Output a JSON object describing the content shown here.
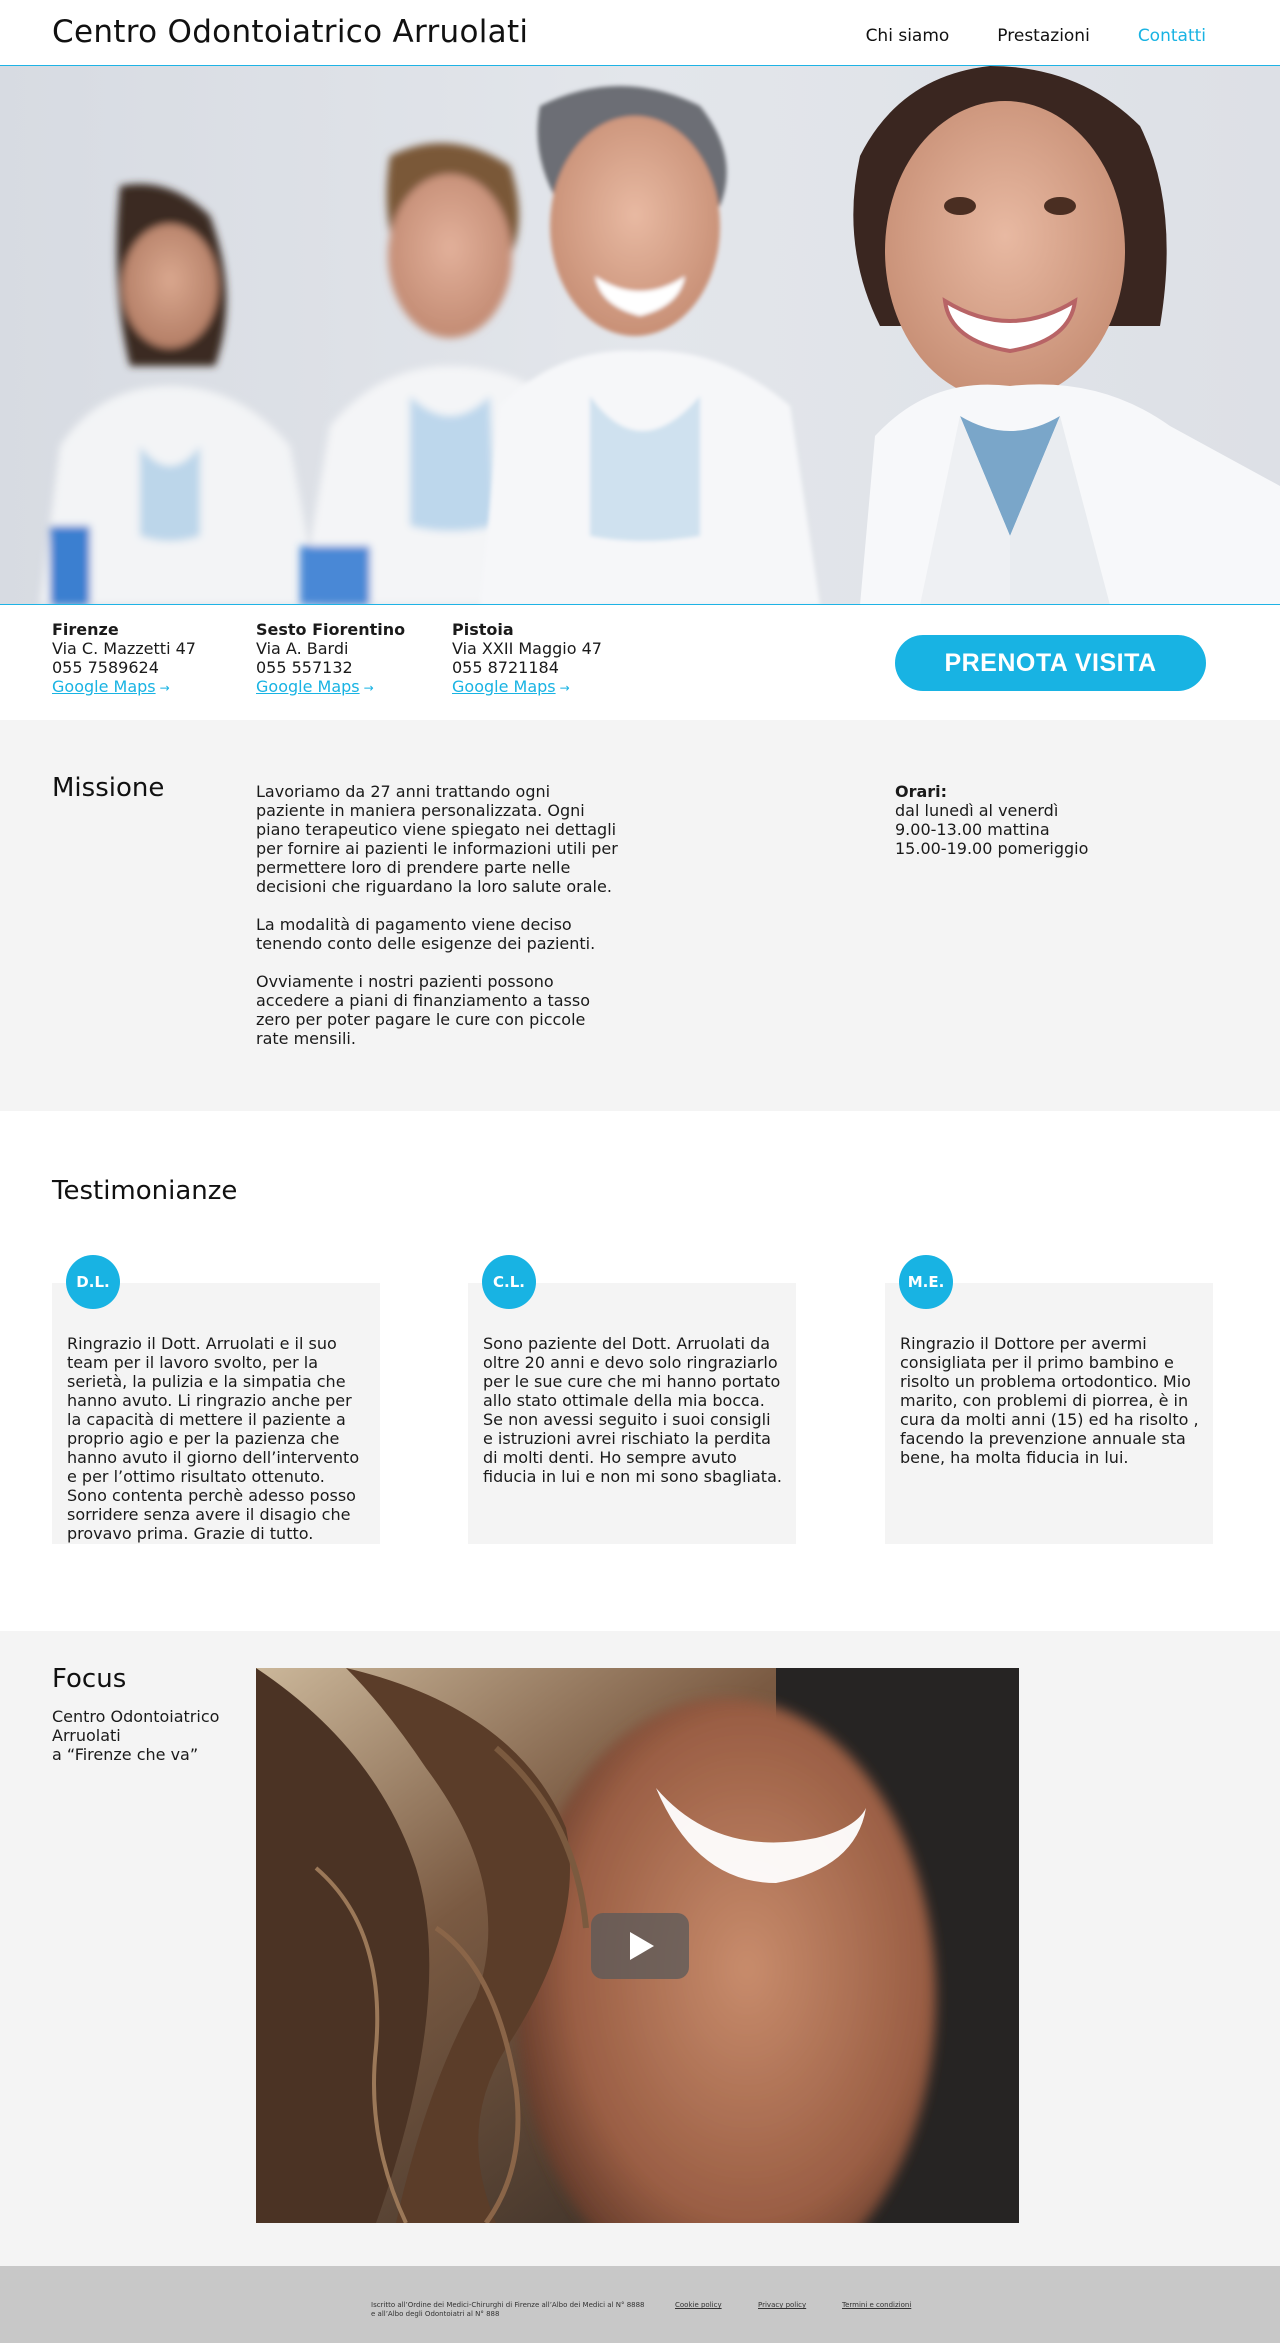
{
  "header": {
    "brand": "Centro Odontoiatrico Arruolati",
    "nav": [
      {
        "label": "Chi siamo",
        "active": false
      },
      {
        "label": "Prestazioni",
        "active": false
      },
      {
        "label": "Contatti",
        "active": true
      }
    ]
  },
  "hero": {
    "image": "portrait of four smiling dentists in white coats"
  },
  "locations": [
    {
      "city": "Firenze",
      "address": "Via C. Mazzetti 47",
      "phone": "055 7589624",
      "maps": "Google Maps"
    },
    {
      "city": "Sesto Fiorentino",
      "address": "Via A. Bardi",
      "phone": "055 557132",
      "maps": "Google Maps"
    },
    {
      "city": "Pistoia",
      "address": "Via XXII Maggio 47",
      "phone": "055 8721184",
      "maps": "Google Maps"
    }
  ],
  "cta": {
    "label": "PRENOTA VISITA"
  },
  "mission": {
    "title": "Missione",
    "paragraphs": [
      "Lavoriamo da 27 anni trattando ogni paziente in maniera personalizzata. Ogni piano terapeutico viene spiegato nei dettagli per fornire ai pazienti le informazioni utili per permettere loro di prendere parte nelle decisioni che riguardano la loro salute orale.",
      "La modalità di pagamento viene deciso tenendo conto delle esigenze dei pazienti.",
      "Ovviamente i nostri pazienti possono accedere a piani di finanziamento a tasso zero per poter pagare le cure con piccole rate mensili."
    ],
    "hours": {
      "label": "Orari:",
      "lines": [
        "dal lunedì al venerdì",
        "9.00-13.00 mattina",
        "15.00-19.00 pomeriggio"
      ]
    }
  },
  "testimonials": {
    "title": "Testimonianze",
    "items": [
      {
        "initials": "D.L.",
        "text": "Ringrazio il Dott. Arruolati e il suo team per il lavoro svolto, per la serietà, la pulizia e la simpatia che hanno avuto. Li ringrazio anche per la capacità di mettere il paziente a proprio agio e per la pazienza che hanno avuto il giorno dell’intervento e per l’ottimo risultato ottenuto. Sono contenta perchè adesso posso sorridere senza avere il disagio che provavo prima. Grazie di tutto."
      },
      {
        "initials": "C.L.",
        "text": "Sono paziente del Dott. Arruolati da oltre 20 anni e devo solo ringraziarlo per le sue cure che mi hanno portato allo stato ottimale della mia bocca. Se non avessi seguito i suoi consigli e istruzioni avrei rischiato la perdita di molti denti. Ho sempre avuto fiducia in lui e non mi sono sbagliata."
      },
      {
        "initials": "M.E.",
        "text": "Ringrazio il Dottore per avermi consigliata per il primo bambino e risolto un problema ortodontico. Mio marito, con problemi di piorrea, è in cura da molti anni (15) ed ha risolto , facendo la prevenzione annuale sta bene, ha molta fiducia in lui."
      }
    ]
  },
  "focus": {
    "title": "Focus",
    "subtitle_lines": [
      "Centro Odontoiatrico",
      "Arruolati",
      "a “Firenze che va”"
    ],
    "video": {
      "image": "close-up of a laughing woman with wavy hair"
    }
  },
  "footer": {
    "legal_lines": [
      "Iscritto all’Ordine dei Medici-Chirurghi di Firenze all’Albo dei Medici al N° 8888",
      "e all’Albo degli Odontoiatri al N° 888"
    ],
    "links": [
      "Cookie policy",
      "Privacy policy",
      "Termini e condizioni"
    ]
  },
  "colors": {
    "accent": "#18b3e3",
    "section_bg": "#f4f4f4",
    "footer_bg": "#c8c8c8"
  }
}
